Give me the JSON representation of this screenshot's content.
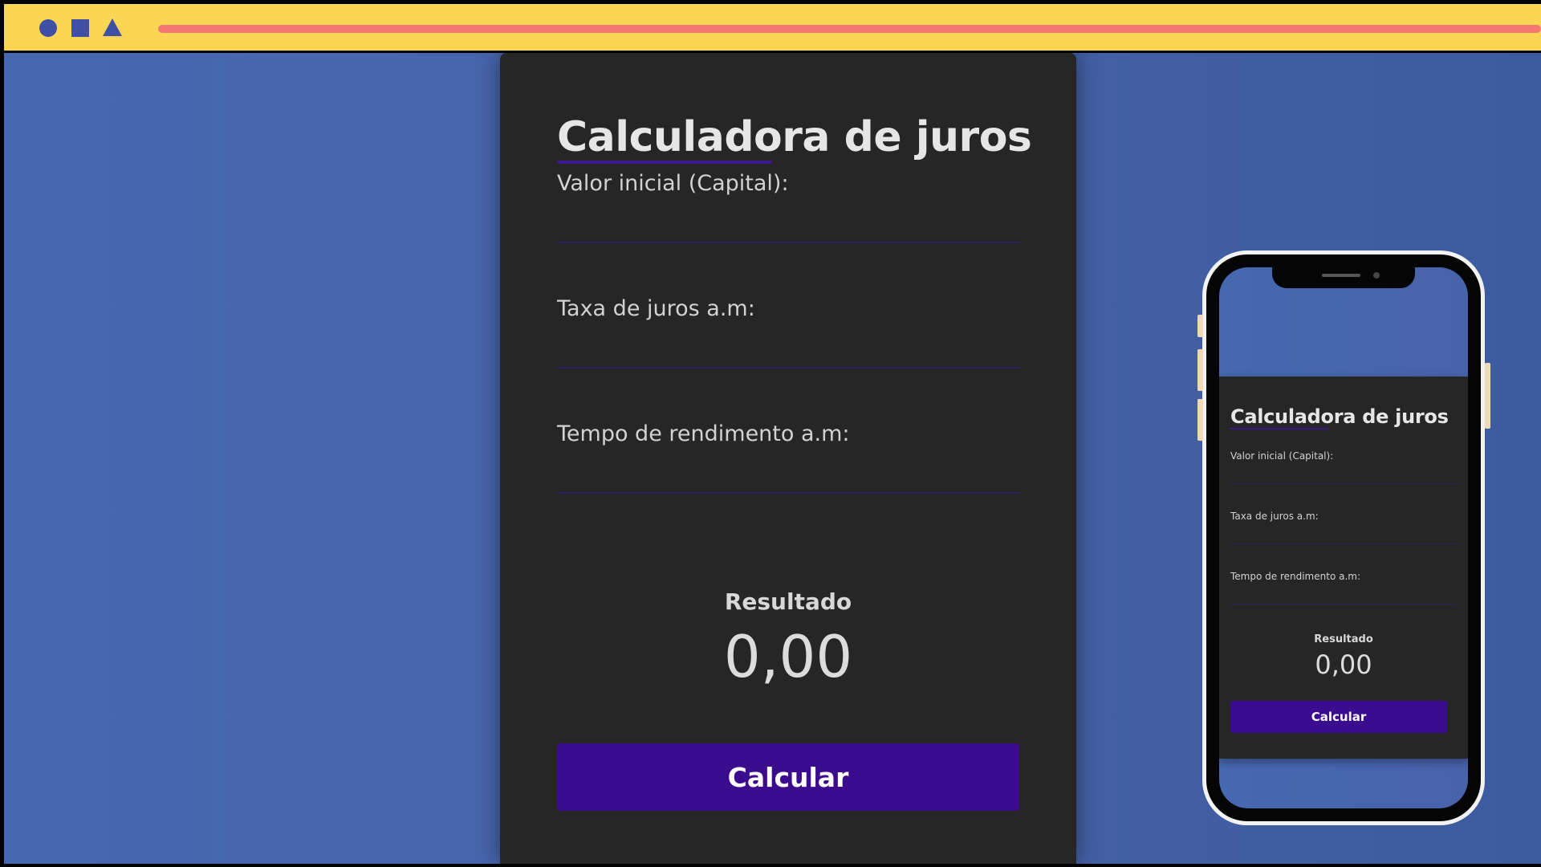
{
  "browser": {
    "icons": [
      "circle-icon",
      "square-icon",
      "triangle-icon"
    ],
    "colors": {
      "bar": "#fbd654",
      "shapes": "#3f4fa3",
      "url_bar": "#f47870"
    }
  },
  "app": {
    "title": "Calculadora de juros",
    "fields": [
      {
        "label": "Valor inicial (Capital):",
        "value": ""
      },
      {
        "label": "Taxa de juros a.m:",
        "value": ""
      },
      {
        "label": "Tempo de rendimento a.m:",
        "value": ""
      }
    ],
    "result_label": "Resultado",
    "result_value": "0,00",
    "button_label": "Calcular",
    "colors": {
      "card": "#262626",
      "accent": "#3b0c8e",
      "background": "#4668b0"
    }
  },
  "mobile_preview": {
    "title": "Calculadora de juros",
    "fields": [
      {
        "label": "Valor inicial (Capital):"
      },
      {
        "label": "Taxa de juros a.m:"
      },
      {
        "label": "Tempo de rendimento a.m:"
      }
    ],
    "result_label": "Resultado",
    "result_value": "0,00",
    "button_label": "Calcular"
  }
}
